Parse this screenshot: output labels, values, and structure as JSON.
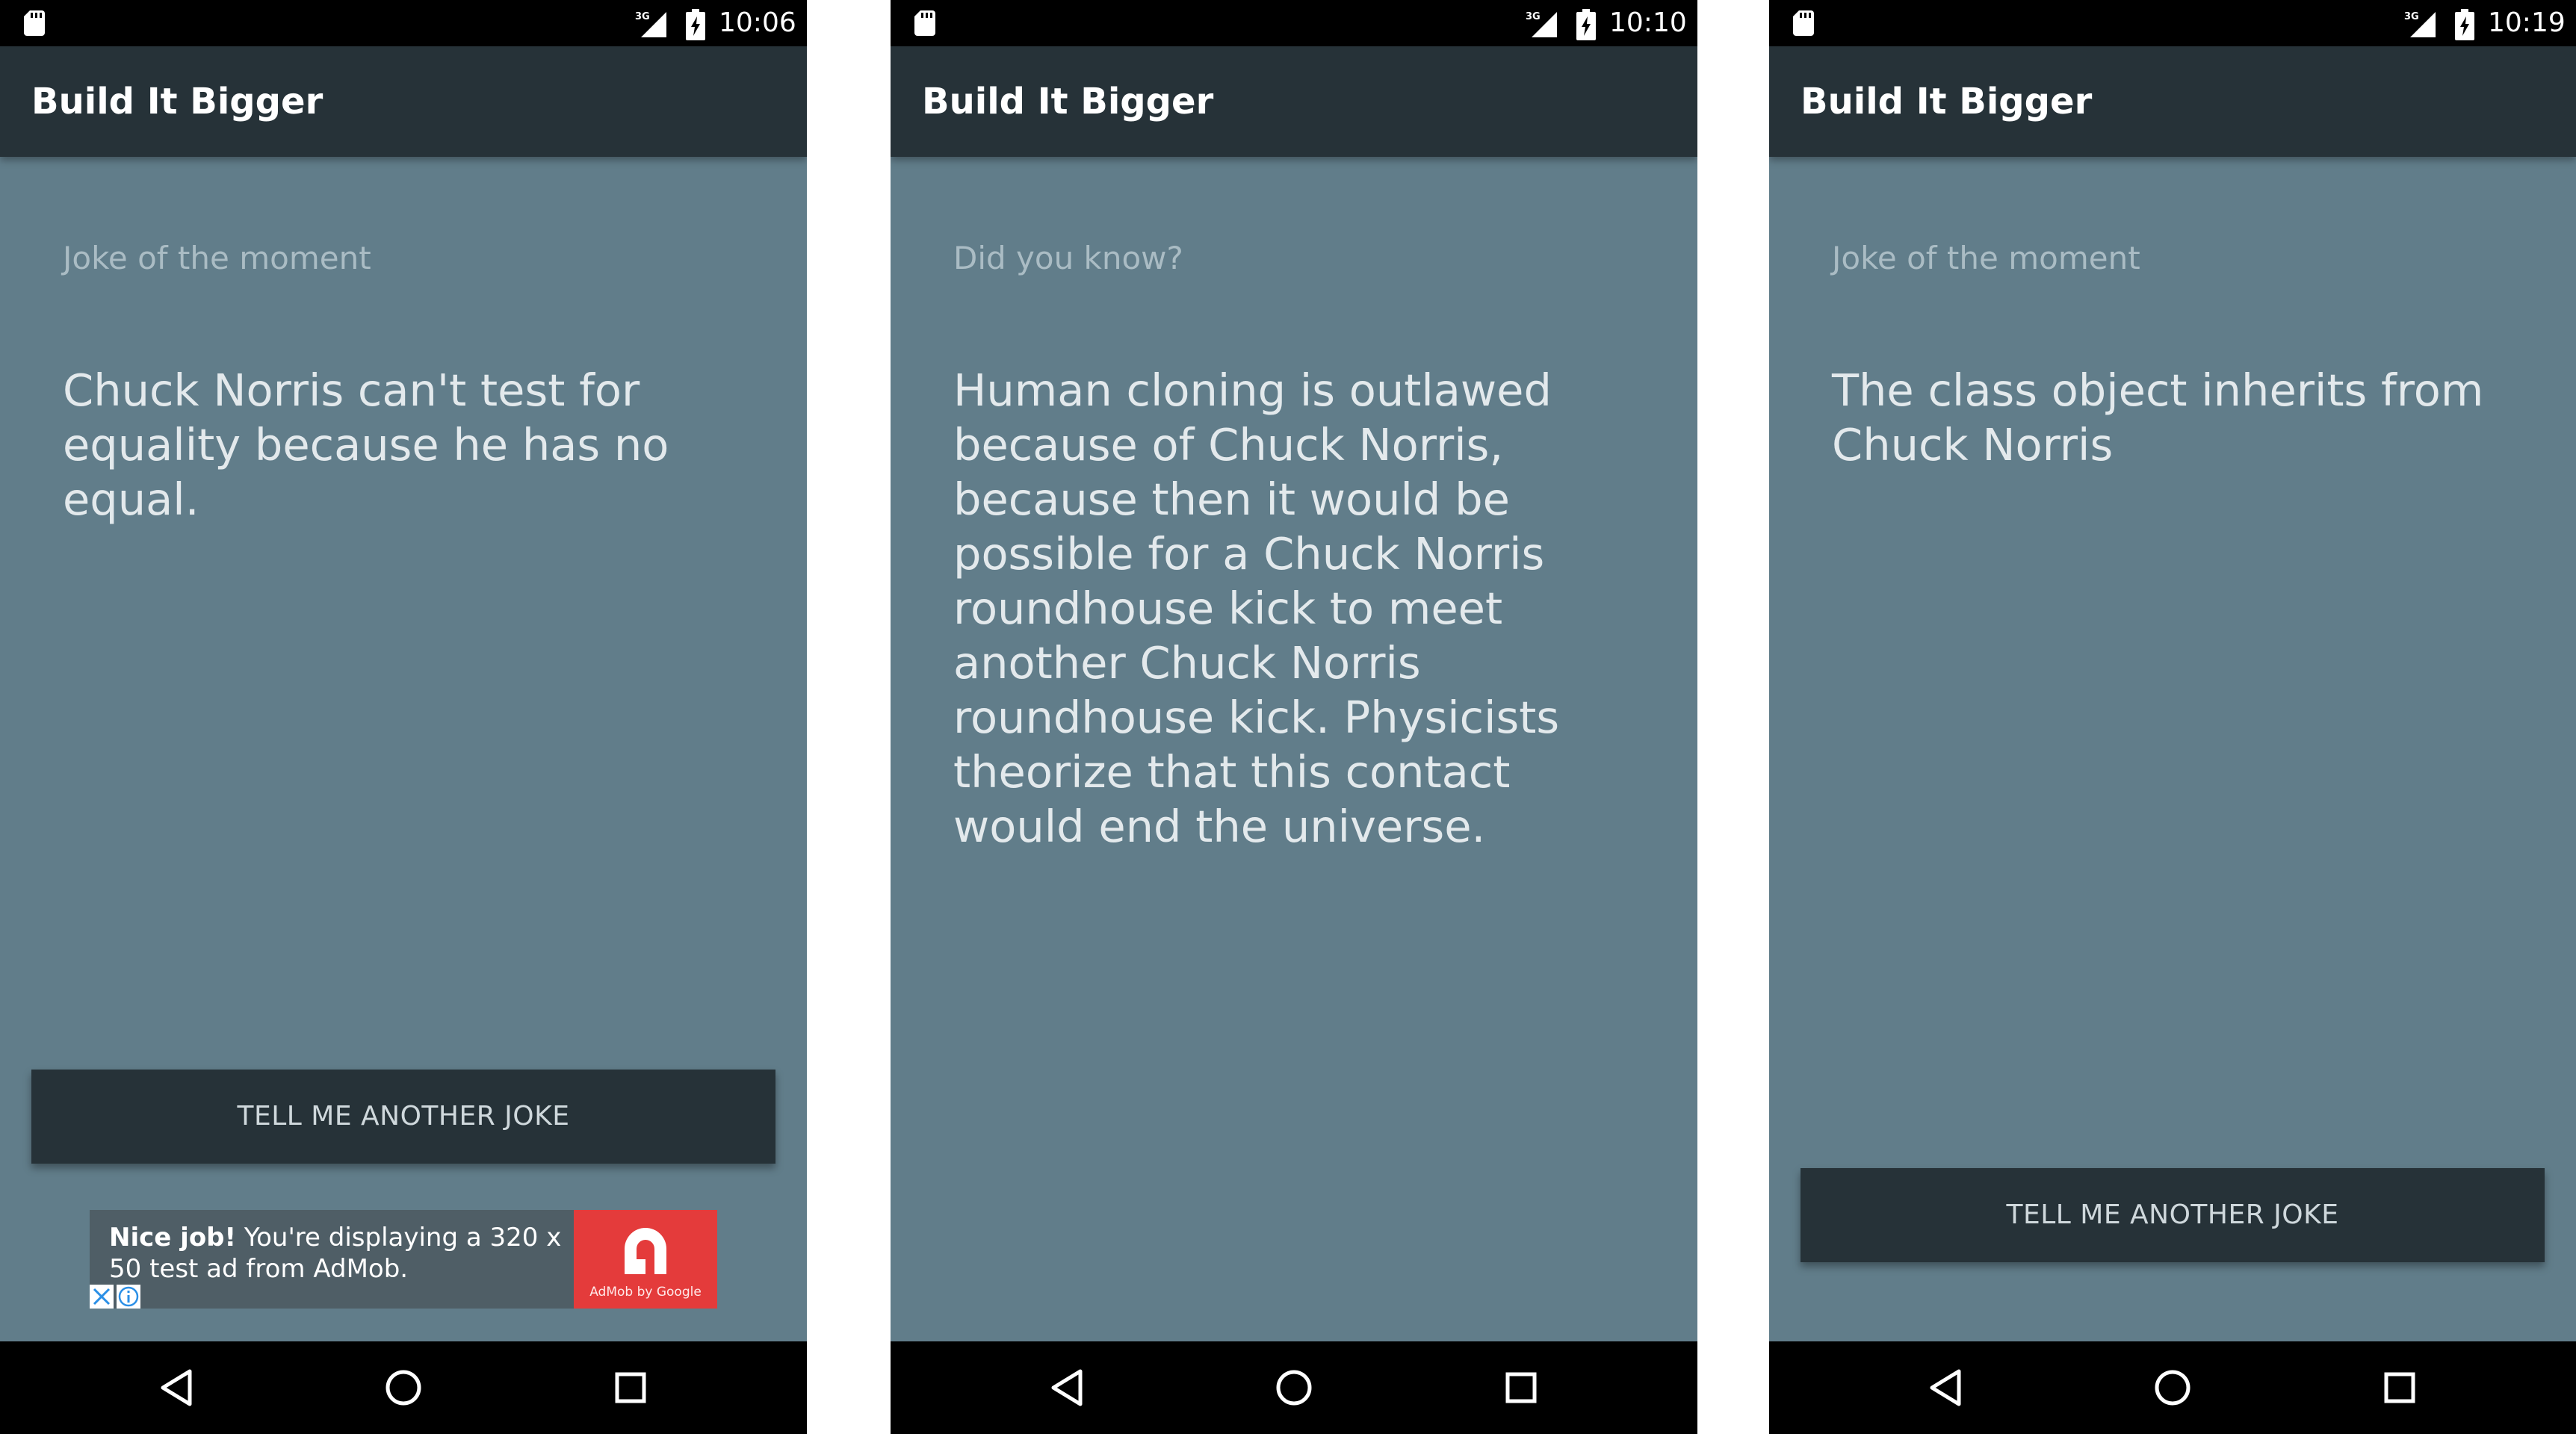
{
  "screens": [
    {
      "status_bar": {
        "network": "3G",
        "time": "10:06"
      },
      "app_bar": {
        "title": "Build It Bigger"
      },
      "content": {
        "subtitle": "Joke of the moment",
        "joke": "Chuck Norris can't test for equality because he has no equal."
      },
      "button": {
        "label": "TELL ME ANOTHER JOKE"
      },
      "ad": {
        "headline": "Nice job!",
        "body": "You're displaying a 320 x 50 test ad from AdMob.",
        "logo_text": "AdMob by Google"
      }
    },
    {
      "status_bar": {
        "network": "3G",
        "time": "10:10"
      },
      "app_bar": {
        "title": "Build It Bigger"
      },
      "content": {
        "subtitle": "Did you know?",
        "joke": "Human cloning is outlawed because of Chuck Norris, because then it would be possible for a Chuck Norris roundhouse kick to meet another Chuck Norris roundhouse kick. Physicists theorize that this contact would end the universe."
      }
    },
    {
      "status_bar": {
        "network": "3G",
        "time": "10:19"
      },
      "app_bar": {
        "title": "Build It Bigger"
      },
      "content": {
        "subtitle": "Joke of the moment",
        "joke": "The class object inherits from Chuck Norris"
      },
      "button": {
        "label": "TELL ME ANOTHER JOKE"
      }
    }
  ],
  "icons": {
    "sd_card": "sd-card-icon",
    "signal": "signal-3g-icon",
    "battery": "battery-charging-icon",
    "nav_back": "back-triangle-icon",
    "nav_home": "home-circle-icon",
    "nav_recents": "recents-square-icon",
    "ad_close": "ad-close-icon",
    "ad_info": "ad-info-icon"
  },
  "colors": {
    "app_bar": "#263238",
    "background": "#617d8a",
    "button": "#263238",
    "ad_logo": "#e43b3b"
  }
}
